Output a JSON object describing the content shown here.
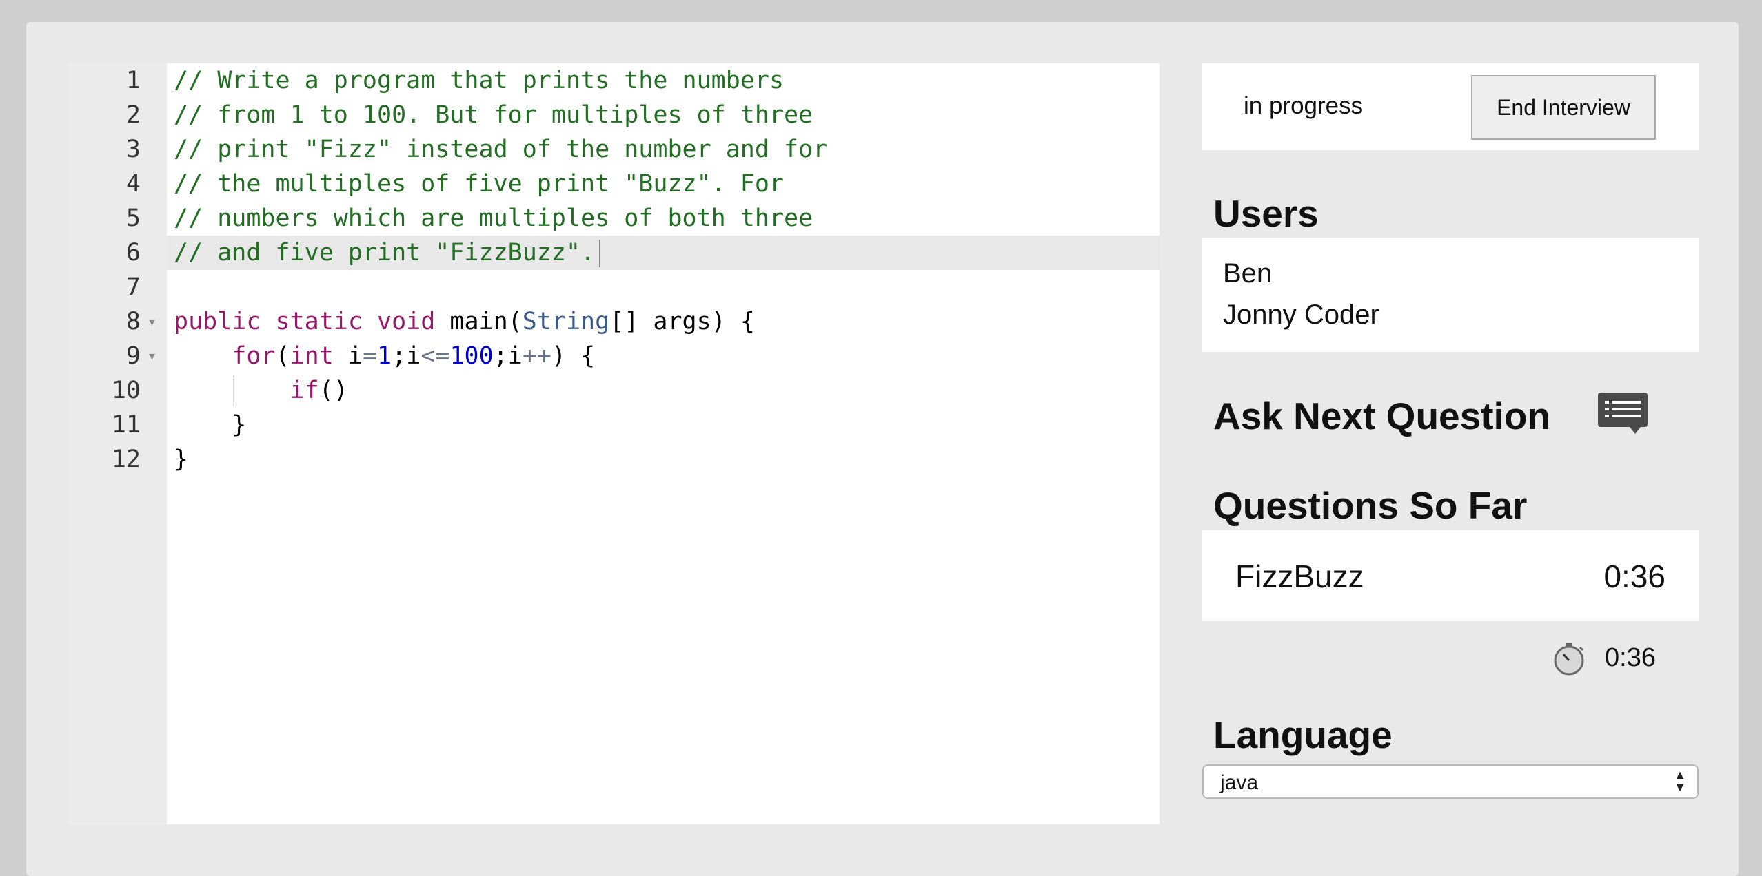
{
  "editor": {
    "line_numbers": [
      "1",
      "2",
      "3",
      "4",
      "5",
      "6",
      "7",
      "8",
      "9",
      "10",
      "11",
      "12"
    ],
    "active_line": 6,
    "fold_lines": [
      8,
      9
    ],
    "lines": [
      [
        {
          "t": "// Write a program that prints the numbers",
          "c": "comment"
        }
      ],
      [
        {
          "t": "// from 1 to 100. But for multiples of three",
          "c": "comment"
        }
      ],
      [
        {
          "t": "// print \"Fizz\" instead of the number and for",
          "c": "comment"
        }
      ],
      [
        {
          "t": "// the multiples of five print \"Buzz\". For",
          "c": "comment"
        }
      ],
      [
        {
          "t": "// numbers which are multiples of both three",
          "c": "comment"
        }
      ],
      [
        {
          "t": "// and five print \"FizzBuzz\".",
          "c": "comment"
        }
      ],
      [],
      [
        {
          "t": "public",
          "c": "kw"
        },
        {
          "t": " "
        },
        {
          "t": "static",
          "c": "kw"
        },
        {
          "t": " "
        },
        {
          "t": "void",
          "c": "kw"
        },
        {
          "t": " main("
        },
        {
          "t": "String",
          "c": "type"
        },
        {
          "t": "[] args) {"
        }
      ],
      [
        {
          "t": "    "
        },
        {
          "t": "for",
          "c": "kw"
        },
        {
          "t": "("
        },
        {
          "t": "int",
          "c": "kw"
        },
        {
          "t": " i"
        },
        {
          "t": "=",
          "c": "op"
        },
        {
          "t": "1",
          "c": "num"
        },
        {
          "t": ";i"
        },
        {
          "t": "<=",
          "c": "op"
        },
        {
          "t": "100",
          "c": "num"
        },
        {
          "t": ";i"
        },
        {
          "t": "++",
          "c": "op"
        },
        {
          "t": ") {"
        }
      ],
      [
        {
          "t": "        "
        },
        {
          "t": "if",
          "c": "kw"
        },
        {
          "t": "()"
        }
      ],
      [
        {
          "t": "    }"
        }
      ],
      [
        {
          "t": "}"
        }
      ]
    ]
  },
  "status": {
    "text": "in progress",
    "end_button": "End Interview"
  },
  "users": {
    "title": "Users",
    "names": [
      "Ben",
      "Jonny Coder"
    ]
  },
  "ask": {
    "title": "Ask Next Question",
    "icon": "question-list-icon"
  },
  "questions": {
    "title": "Questions So Far",
    "items": [
      {
        "name": "FizzBuzz",
        "time": "0:36"
      }
    ],
    "timer": "0:36",
    "timer_icon": "stopwatch-icon"
  },
  "language": {
    "title": "Language",
    "selected": "java"
  },
  "colors": {
    "comment": "#236e24",
    "keyword": "#931a68",
    "type": "#3a5a8a",
    "number": "#0000cd",
    "operator": "#687687",
    "background": "#e9e9e9",
    "panel": "#ffffff"
  }
}
